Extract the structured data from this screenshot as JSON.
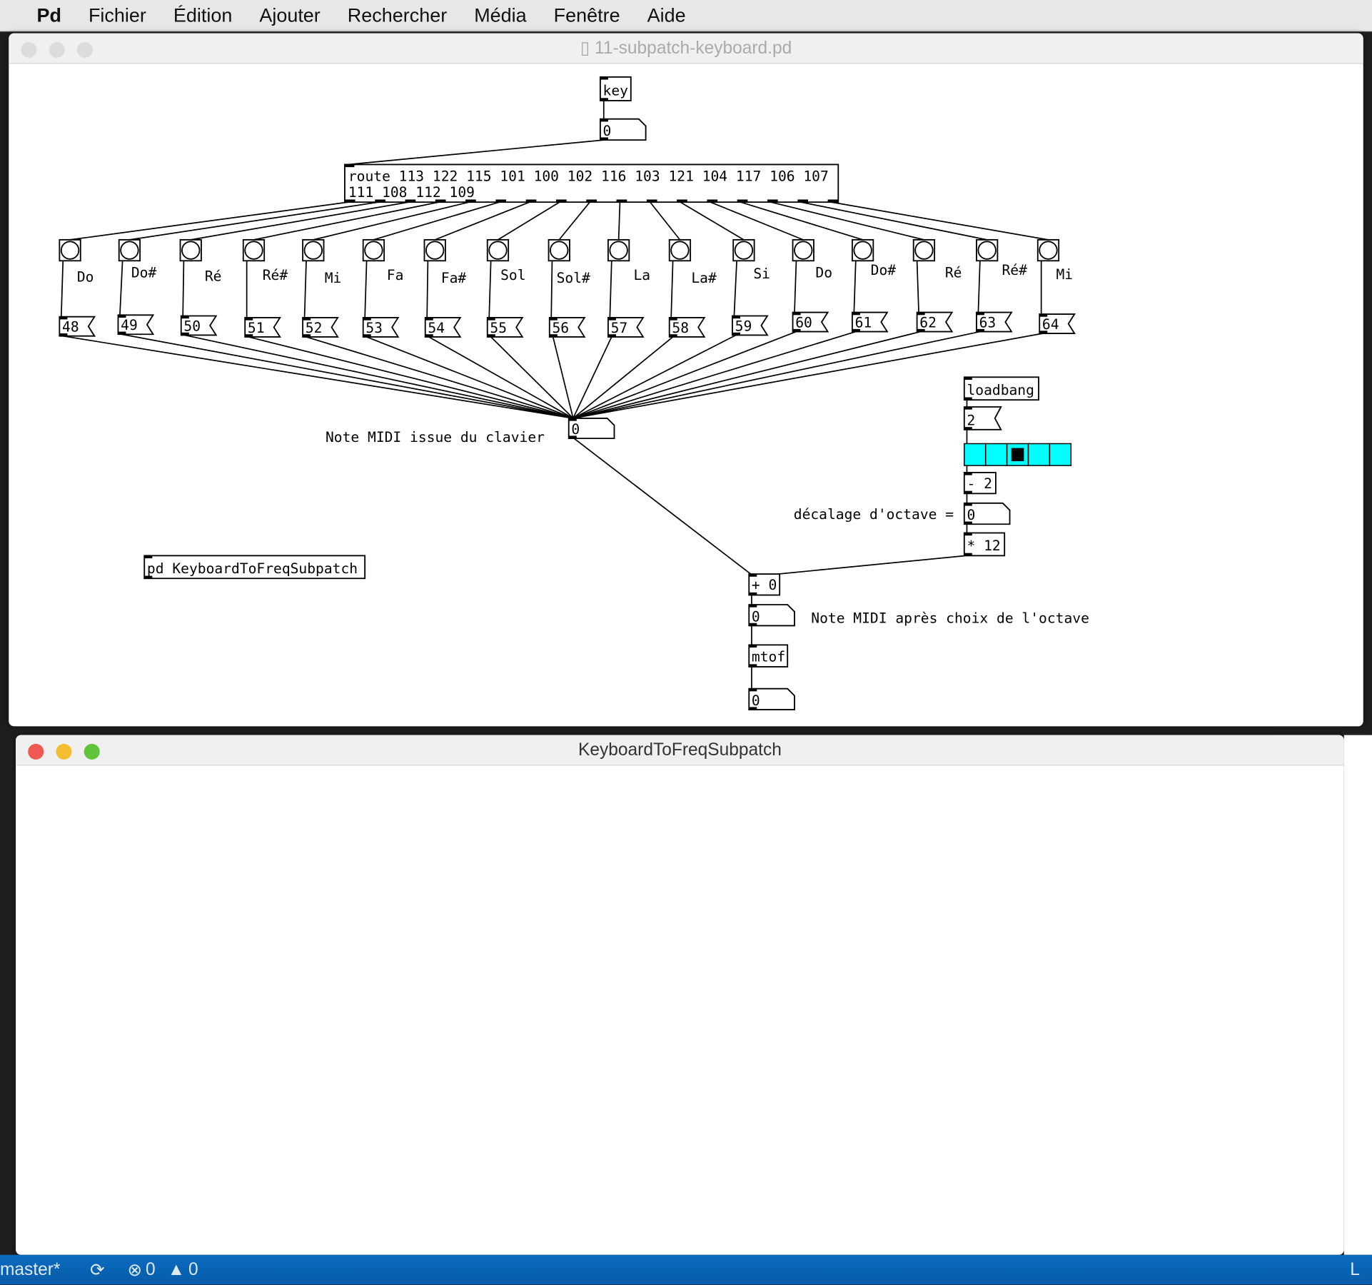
{
  "menubar": {
    "app": "Pd",
    "items": [
      "Fichier",
      "Édition",
      "Ajouter",
      "Rechercher",
      "Média",
      "Fenêtre",
      "Aide"
    ]
  },
  "window1": {
    "title": "11-subpatch-keyboard.pd"
  },
  "window2": {
    "title": "KeyboardToFreqSubpatch"
  },
  "patch": {
    "key": "key",
    "key_number": "0",
    "route": [
      "route 113 122 115 101 100 102 116 103 121 104 117 106 107",
      "111 108 112 109"
    ],
    "note_labels": [
      "Do",
      "Do#",
      "Ré",
      "Ré#",
      "Mi",
      "Fa",
      "Fa#",
      "Sol",
      "Sol#",
      "La",
      "La#",
      "Si",
      "Do",
      "Do#",
      "Ré",
      "Ré#",
      "Mi"
    ],
    "note_values": [
      "48",
      "49",
      "50",
      "51",
      "52",
      "53",
      "54",
      "55",
      "56",
      "57",
      "58",
      "59",
      "60",
      "61",
      "62",
      "63",
      "64"
    ],
    "center_number": "0",
    "comment_note": "Note MIDI issue du clavier",
    "loadbang": "loadbang",
    "init_msg": "2",
    "radio": {
      "cells": 5,
      "selected": 2,
      "color": "#00ffff"
    },
    "minus": "- 2",
    "octave_comment": "décalage d'octave =",
    "octave_number": "0",
    "times": "* 12",
    "plus": "+ 0",
    "plus_number": "0",
    "comment_after": "Note MIDI après choix de l'octave",
    "mtof": "mtof",
    "freq_number": "0",
    "subpatch": "pd KeyboardToFreqSubpatch"
  },
  "statusbar": {
    "branch": "master*",
    "errors": "0",
    "warnings": "0",
    "right": "L"
  },
  "colors": {
    "statusbar": "#0a6bc0",
    "radio": "#00ffff"
  }
}
